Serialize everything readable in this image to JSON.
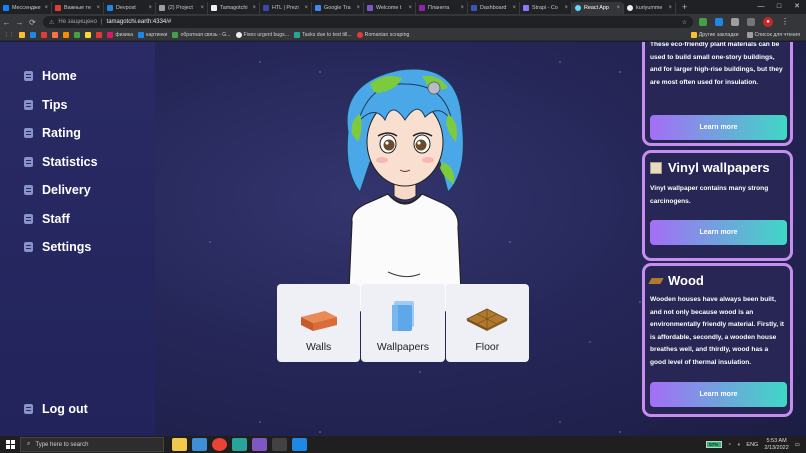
{
  "browser": {
    "tabs": [
      {
        "label": "Мессенджер",
        "color": "#0a84ff"
      },
      {
        "label": "Важные те",
        "color": "#e53935"
      },
      {
        "label": "Devpost",
        "color": "#1e88e5"
      },
      {
        "label": "(2) Project",
        "color": "#9e9e9e"
      },
      {
        "label": "Tamagotchi",
        "color": "#eeeeee"
      },
      {
        "label": "HTL | Prezi",
        "color": "#3949ab"
      },
      {
        "label": "Google Tra",
        "color": "#4285f4"
      },
      {
        "label": "Welcome t",
        "color": "#7e57c2"
      },
      {
        "label": "Планета",
        "color": "#8e24aa"
      },
      {
        "label": "Dashboard",
        "color": "#3f51b5"
      },
      {
        "label": "Strapi - Co",
        "color": "#8e75ff"
      },
      {
        "label": "React App",
        "color": "#61dafb",
        "active": true
      },
      {
        "label": "kuriyumme",
        "color": "#eeeeee"
      }
    ],
    "new_tab_glyph": "+",
    "window_controls": [
      "—",
      "□",
      "✕"
    ],
    "insecure_label": "Не защищено",
    "url": "tamagotchi.earth:4334/#",
    "bookmarks": [
      {
        "label": "",
        "color": "#fbc02d"
      },
      {
        "label": "",
        "color": "#1e88e5"
      },
      {
        "label": "",
        "color": "#e53935"
      },
      {
        "label": "",
        "color": "#ff7043"
      },
      {
        "label": "",
        "color": "#fb8c00"
      },
      {
        "label": "",
        "color": "#43a047"
      },
      {
        "label": "",
        "color": "#fdd835"
      },
      {
        "label": "",
        "color": "#e53935"
      },
      {
        "label": "физика",
        "color": "#d81b60"
      },
      {
        "label": "картинки",
        "color": "#1e88e5"
      },
      {
        "label": "обратная связь - G...",
        "color": "#43a047"
      },
      {
        "label": "Fixes urgent bugs...",
        "color": "#eeeeee"
      },
      {
        "label": "Tasks due to test till...",
        "color": "#26a69a"
      },
      {
        "label": "Romanian scraping",
        "color": "#e53935"
      }
    ],
    "bookmarks_right": [
      "Другие закладки",
      "Список для чтения"
    ]
  },
  "sidebar": {
    "items": [
      {
        "label": "Home"
      },
      {
        "label": "Tips"
      },
      {
        "label": "Rating"
      },
      {
        "label": "Statistics"
      },
      {
        "label": "Delivery"
      },
      {
        "label": "Staff"
      },
      {
        "label": "Settings"
      }
    ],
    "logout": "Log out"
  },
  "materials": [
    {
      "label": "Walls",
      "icon": "brick-icon"
    },
    {
      "label": "Wallpapers",
      "icon": "wallpaper-roll-icon"
    },
    {
      "label": "Floor",
      "icon": "parquet-icon"
    }
  ],
  "cards": [
    {
      "title": "",
      "text": "These eco-friendly plant materials can be used to build small one-story buildings, and for larger high-rise buildings, but they are most often used for insulation.",
      "button": "Learn more"
    },
    {
      "title": "Vinyl wallpapers",
      "text": "Vinyl wallpaper contains many strong carcinogens.",
      "button": "Learn more"
    },
    {
      "title": "Wood",
      "text": "Wooden houses have always been built, and not only because wood is an environmentally friendly material. Firstly, it is affordable, secondly, a wooden house breathes well, and thirdly, wood has a good level of thermal insulation.",
      "button": "Learn more"
    }
  ],
  "taskbar": {
    "search_placeholder": "Type here to search",
    "battery": "57%",
    "lang": "ENG",
    "time": "5:53 AM",
    "date": "2/13/2022"
  }
}
